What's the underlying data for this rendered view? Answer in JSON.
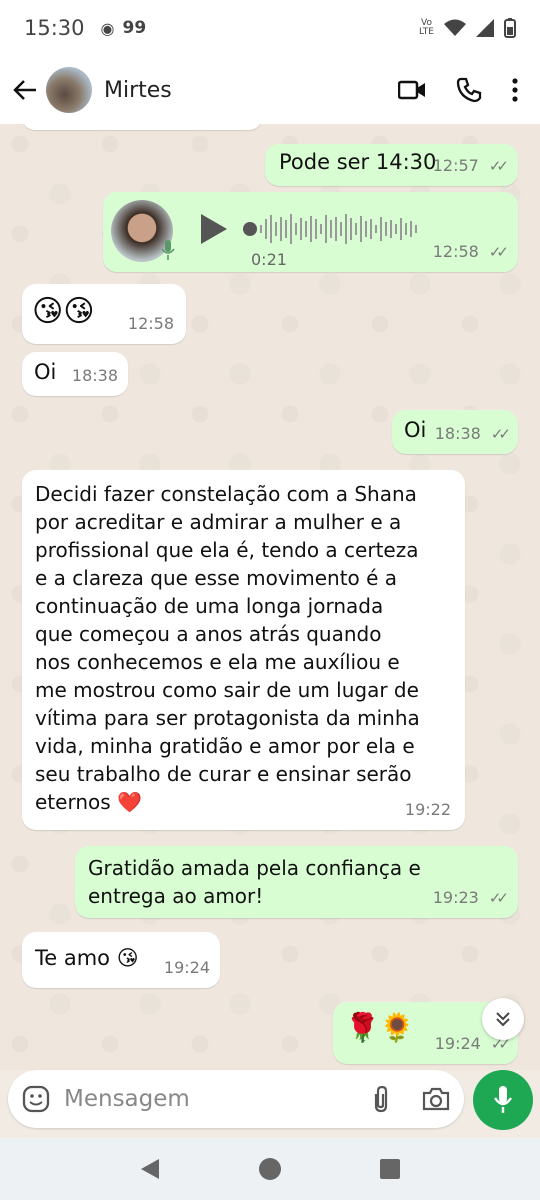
{
  "status": {
    "time": "15:30",
    "badge": "99"
  },
  "contact": {
    "name": "Mirtes"
  },
  "messages": [
    {
      "id": "m1",
      "text": "Pode ser 14:30",
      "time": "12:57"
    },
    {
      "id": "m2",
      "duration": "0:21",
      "time": "12:58"
    },
    {
      "id": "m3",
      "text": "😘😘",
      "time": "12:58"
    },
    {
      "id": "m4",
      "text": "Oi",
      "time": "18:38"
    },
    {
      "id": "m5",
      "text": "Oi",
      "time": "18:38"
    },
    {
      "id": "m6",
      "lines": [
        "Decidi fazer constelação com a Shana",
        "por acreditar e admirar a mulher e a",
        "profissional que ela é, tendo a certeza",
        "e a clareza que esse movimento é a",
        "continuação de uma longa jornada",
        "que começou a anos atrás quando",
        "nos conhecemos e ela me auxíliou e",
        "me mostrou como sair de um lugar de",
        "vítima para ser protagonista da minha",
        "vida, minha gratidão e amor por ela e",
        "seu trabalho de curar e ensinar serão",
        "eternos ❤️"
      ],
      "time": "19:22"
    },
    {
      "id": "m7",
      "lines": [
        "Gratidão amada pela confiança e",
        "entrega ao amor!"
      ],
      "time": "19:23"
    },
    {
      "id": "m8",
      "text": "Te amo 😘",
      "time": "19:24"
    },
    {
      "id": "m9",
      "text": "🌹🌻",
      "time": "19:24"
    }
  ],
  "input": {
    "placeholder": "Mensagem"
  },
  "colors": {
    "outgoing": "#d9fdd3",
    "incoming": "#ffffff",
    "accent": "#1ea853"
  }
}
